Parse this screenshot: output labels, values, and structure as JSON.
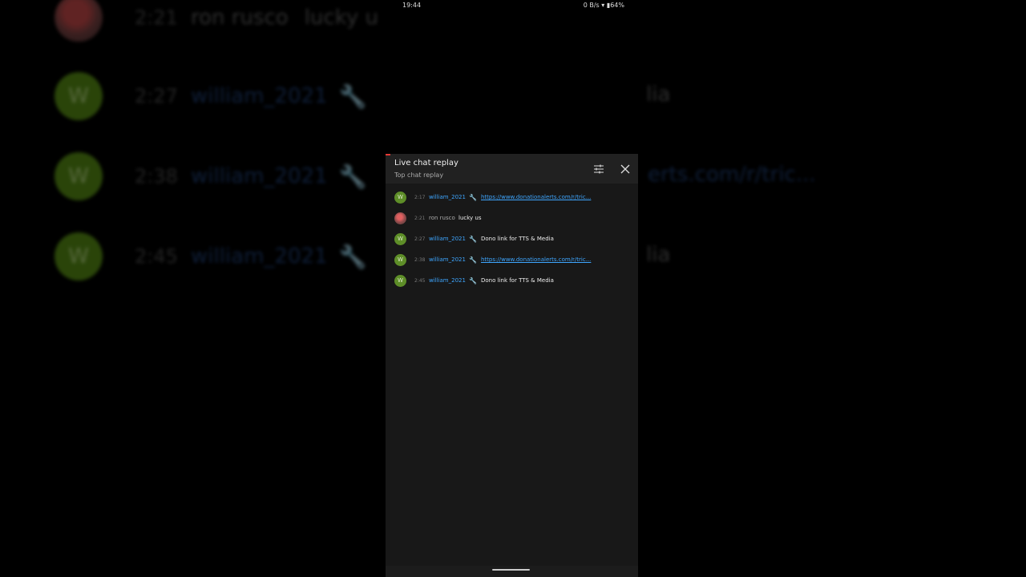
{
  "status_bar": {
    "time": "19:44",
    "network_speed": "0 B/s",
    "battery": "64%"
  },
  "chat_panel": {
    "title": "Live chat replay",
    "subtitle": "Top chat replay"
  },
  "messages": [
    {
      "avatar_letter": "W",
      "time": "2:17",
      "author": "william_2021",
      "badge": "wrench-icon",
      "text": "https://www.donationalerts.com/r/tric...",
      "is_link": true
    },
    {
      "avatar_letter": "",
      "time": "2:21",
      "author": "ron rusco",
      "badge": "",
      "text": "lucky us",
      "is_link": false
    },
    {
      "avatar_letter": "W",
      "time": "2:27",
      "author": "william_2021",
      "badge": "wrench-icon",
      "text": "Dono link for TTS & Media",
      "is_link": false
    },
    {
      "avatar_letter": "W",
      "time": "2:38",
      "author": "william_2021",
      "badge": "wrench-icon",
      "text": "https://www.donationalerts.com/r/tric...",
      "is_link": true
    },
    {
      "avatar_letter": "W",
      "time": "2:45",
      "author": "william_2021",
      "badge": "wrench-icon",
      "text": "Dono link for TTS & Media",
      "is_link": false
    }
  ],
  "background": {
    "rows": [
      {
        "avatar_letter": "",
        "time": "2:21",
        "author": "ron rusco",
        "text": "lucky u",
        "right_text": ""
      },
      {
        "avatar_letter": "W",
        "time": "2:27",
        "author": "william_2021",
        "text": "",
        "right_text": "lia"
      },
      {
        "avatar_letter": "W",
        "time": "2:38",
        "author": "william_2021",
        "text": "",
        "right_text": "erts.com/r/tric..."
      },
      {
        "avatar_letter": "W",
        "time": "2:45",
        "author": "william_2021",
        "text": "",
        "right_text": "lia"
      }
    ]
  },
  "colors": {
    "accent": "#e53935",
    "link": "#3ea6ff",
    "avatar_green": "#5e8e28"
  }
}
